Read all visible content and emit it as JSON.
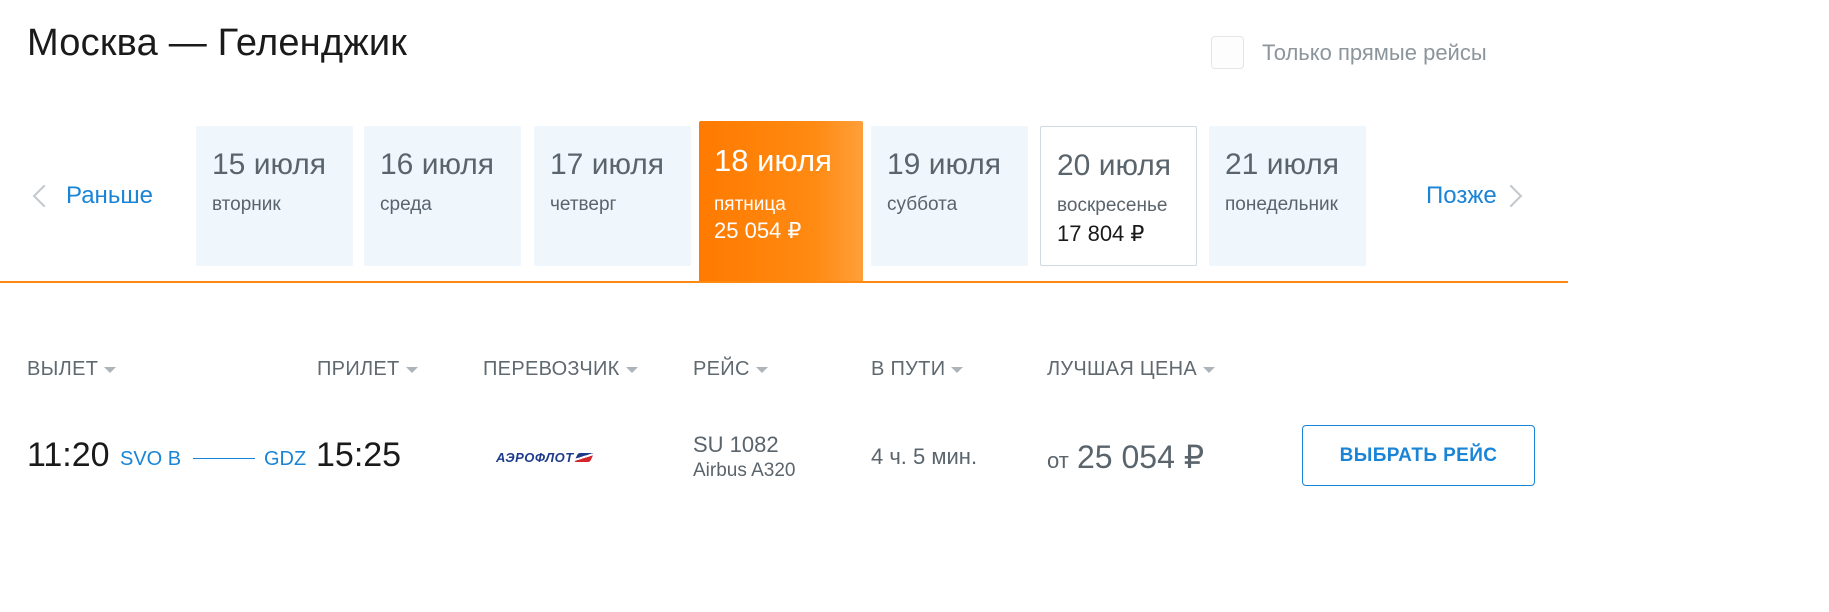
{
  "header": {
    "title": "Москва — Геленджик",
    "direct_only_label": "Только прямые рейсы"
  },
  "date_nav": {
    "prev_label": "Раньше",
    "next_label": "Позже",
    "dates": [
      {
        "date": "15 июля",
        "weekday": "вторник",
        "price": ""
      },
      {
        "date": "16 июля",
        "weekday": "среда",
        "price": ""
      },
      {
        "date": "17 июля",
        "weekday": "четверг",
        "price": ""
      },
      {
        "date": "18 июля",
        "weekday": "пятница",
        "price": "25 054 ₽"
      },
      {
        "date": "19 июля",
        "weekday": "суббота",
        "price": ""
      },
      {
        "date": "20 июля",
        "weekday": "воскресенье",
        "price": "17 804 ₽"
      },
      {
        "date": "21 июля",
        "weekday": "понедельник",
        "price": ""
      }
    ],
    "accent_color": "#ff7a00"
  },
  "columns": {
    "departure": "ВЫЛЕТ",
    "arrival": "ПРИЛЕТ",
    "carrier": "ПЕРЕВОЗЧИК",
    "flight": "РЕЙС",
    "duration": "В ПУТИ",
    "best_price": "ЛУЧШАЯ ЦЕНА"
  },
  "flights": [
    {
      "dep_time": "11:20",
      "dep_airport": "SVO B",
      "arr_airport": "GDZ",
      "arr_time": "15:25",
      "carrier_logo_text": "АЭРОФЛОТ",
      "flight_number": "SU 1082",
      "aircraft": "Airbus A320",
      "duration": "4 ч. 5 мин.",
      "price_prefix": "от",
      "price": "25 054 ₽",
      "select_label": "ВЫБРАТЬ РЕЙС"
    }
  ]
}
